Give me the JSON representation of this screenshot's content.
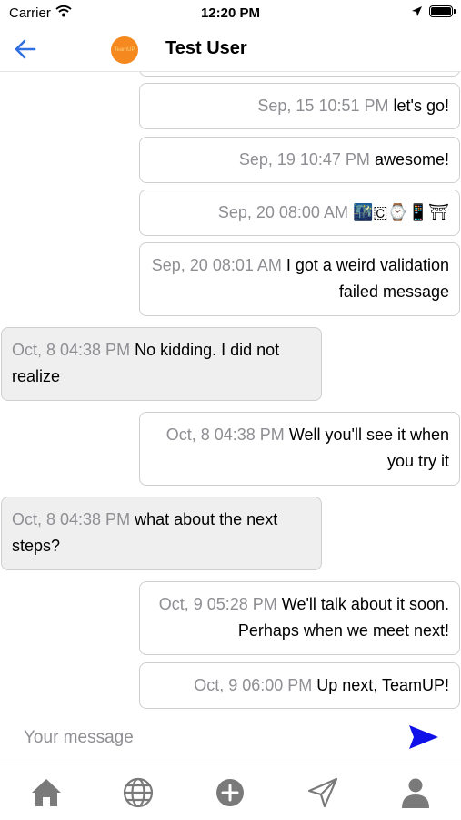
{
  "status_bar": {
    "carrier": "Carrier",
    "time": "12:20 PM",
    "icons": [
      "wifi-icon",
      "location-arrow-icon",
      "battery-icon"
    ]
  },
  "header": {
    "title": "Test User",
    "avatar_text": "TeamUP",
    "back_icon": "back-arrow-icon"
  },
  "messages": [
    {
      "direction": "out",
      "time": "Sep, 15 10:51 PM",
      "text": "let's go!"
    },
    {
      "direction": "out",
      "time": "Sep, 19 10:47 PM",
      "text": "awesome!"
    },
    {
      "direction": "out",
      "time": "Sep, 20 08:00 AM",
      "text": "🌃🇨⌚📱⛩"
    },
    {
      "direction": "out",
      "time": "Sep, 20 08:01 AM",
      "text": "I got a weird validation failed message"
    },
    {
      "direction": "in",
      "time": "Oct, 8 04:38 PM",
      "text": "No kidding. I did not realize"
    },
    {
      "direction": "out",
      "time": "Oct, 8 04:38 PM",
      "text": "Well you'll see it when you try it"
    },
    {
      "direction": "in",
      "time": "Oct, 8 04:38 PM",
      "text": "what about the next steps?"
    },
    {
      "direction": "out",
      "time": "Oct, 9 05:28 PM",
      "text": "We'll talk about it soon. Perhaps when we meet next!"
    },
    {
      "direction": "out",
      "time": "Oct, 9 06:00 PM",
      "text": "Up next, TeamUP!"
    }
  ],
  "composer": {
    "placeholder": "Your message",
    "value": "",
    "send_icon": "send-icon"
  },
  "tab_bar": {
    "items": [
      "home-icon",
      "globe-icon",
      "add-circle-icon",
      "send-arrow-icon",
      "profile-icon"
    ]
  },
  "colors": {
    "accent": "#2f6fe0",
    "send": "#1010e8",
    "avatar": "#f5891f",
    "incoming_bubble": "#efefef"
  }
}
